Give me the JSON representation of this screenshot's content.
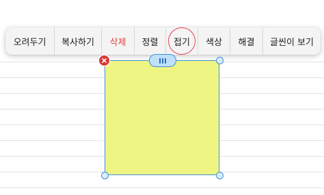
{
  "context_menu": {
    "items": [
      {
        "id": "cut",
        "label": "오려두기"
      },
      {
        "id": "copy",
        "label": "복사하기"
      },
      {
        "id": "delete",
        "label": "삭제"
      },
      {
        "id": "arrange",
        "label": "정렬"
      },
      {
        "id": "collapse",
        "label": "접기"
      },
      {
        "id": "color",
        "label": "색상"
      },
      {
        "id": "release",
        "label": "해결"
      },
      {
        "id": "show-text",
        "label": "글씬이 보기"
      }
    ],
    "highlighted_item": "collapse"
  },
  "sticky_note": {
    "fill_color": "#eff583",
    "border_color": "#3d8fd6",
    "delete_button_color": "#d63a35",
    "highlight_ring_color": "#e4434b",
    "destructive_text_color": "#e0433a"
  }
}
